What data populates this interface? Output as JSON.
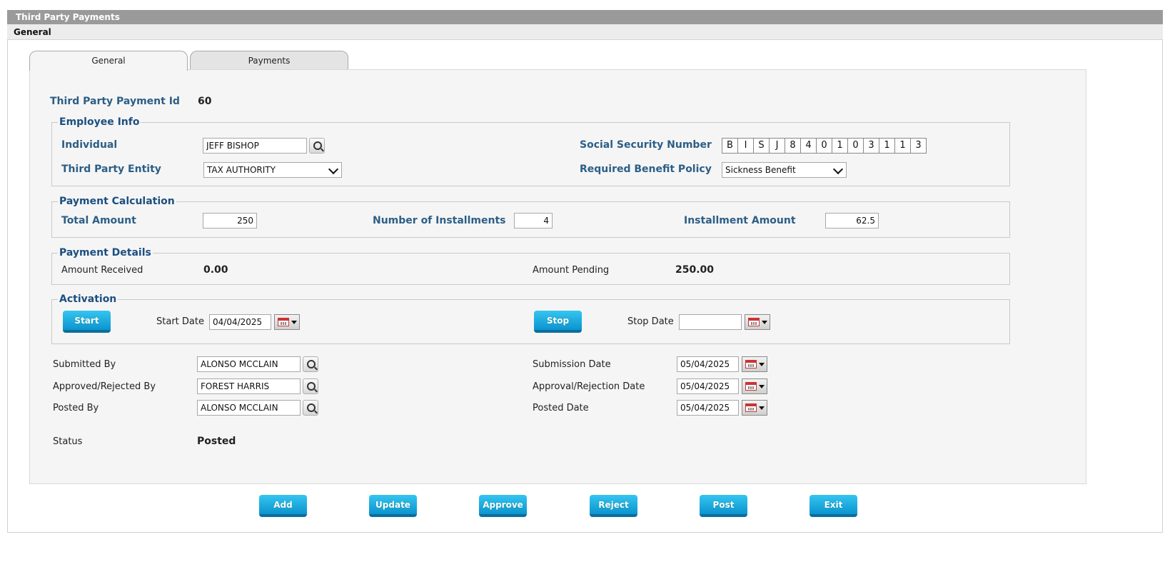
{
  "window": {
    "title": "Third Party Payments",
    "section": "General"
  },
  "tabs": [
    {
      "label": "General"
    },
    {
      "label": "Payments"
    }
  ],
  "header": {
    "id_label": "Third Party Payment Id",
    "id_value": "60"
  },
  "employee_info": {
    "legend": "Employee Info",
    "individual_label": "Individual",
    "individual_value": "JEFF BISHOP",
    "entity_label": "Third Party Entity",
    "entity_value": "TAX AUTHORITY",
    "ssn_label": "Social Security Number",
    "ssn_chars": [
      "B",
      "I",
      "S",
      "J",
      "8",
      "4",
      "0",
      "1",
      "0",
      "3",
      "1",
      "1",
      "3"
    ],
    "policy_label": "Required Benefit Policy",
    "policy_value": "Sickness Benefit"
  },
  "payment_calc": {
    "legend": "Payment Calculation",
    "total_label": "Total Amount",
    "total_value": "250",
    "installments_label": "Number of Installments",
    "installments_value": "4",
    "installment_amount_label": "Installment Amount",
    "installment_amount_value": "62.5"
  },
  "payment_details": {
    "legend": "Payment Details",
    "received_label": "Amount Received",
    "received_value": "0.00",
    "pending_label": "Amount Pending",
    "pending_value": "250.00"
  },
  "activation": {
    "legend": "Activation",
    "start_button": "Start",
    "start_date_label": "Start Date",
    "start_date_value": "04/04/2025",
    "stop_button": "Stop",
    "stop_date_label": "Stop Date",
    "stop_date_value": ""
  },
  "audit": {
    "submitted_by_label": "Submitted By",
    "submitted_by_value": "ALONSO MCCLAIN",
    "approved_by_label": "Approved/Rejected By",
    "approved_by_value": "FOREST HARRIS",
    "posted_by_label": "Posted By",
    "posted_by_value": "ALONSO MCCLAIN",
    "submission_date_label": "Submission Date",
    "submission_date_value": "05/04/2025",
    "approval_date_label": "Approval/Rejection Date",
    "approval_date_value": "05/04/2025",
    "posted_date_label": "Posted Date",
    "posted_date_value": "05/04/2025",
    "status_label": "Status",
    "status_value": "Posted"
  },
  "actions": {
    "add": "Add",
    "update": "Update",
    "approve": "Approve",
    "reject": "Reject",
    "post": "Post",
    "exit": "Exit"
  },
  "colors": {
    "label_blue": "#2c5e86",
    "button_blue": "#0c93cf",
    "title_gray": "#9a9a9a"
  }
}
